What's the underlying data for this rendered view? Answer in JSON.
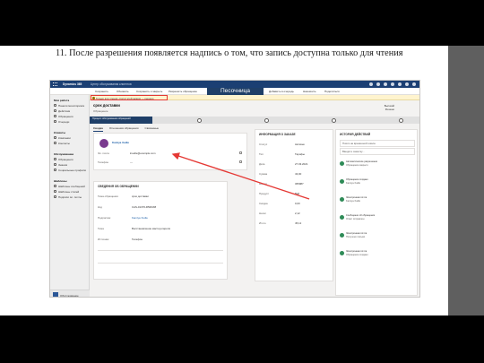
{
  "slide": {
    "caption": "11. После разрешения появляется надпись о том, что запись доступна только для чтения",
    "colors": {
      "background": "#000000",
      "slide": "#ffffff",
      "right_band": "#5f5f5f",
      "arrow": "#e53935"
    }
  },
  "app": {
    "brand": "Dynamics 365",
    "env": "Центр обслуживания клиентов",
    "sandbox_label": "Песочница",
    "commands": [
      "Сохранить",
      "Обновить",
      "Сохранить и закрыть",
      "Разрешить обращение",
      "Отменить обращение",
      "Добавить в очередь",
      "Назначить",
      "Поделиться"
    ],
    "banner_text": "Только для чтения: статус этой записи — решено",
    "sidebar": {
      "groups": [
        {
          "title": "Моя работа",
          "items": [
            "Панели мониторинга",
            "Действия",
            "Обращения",
            "Очереди"
          ]
        },
        {
          "title": "Клиенты",
          "items": [
            "Компании",
            "Контакты"
          ]
        },
        {
          "title": "Обслуживание",
          "items": [
            "Обращения",
            "Знания",
            "Социальные профили"
          ]
        },
        {
          "title": "Шаблоны",
          "items": [
            "Шаблоны сообщений",
            "Шаблоны статей",
            "Подписи эл. почты"
          ]
        }
      ],
      "area_label": "Обслуживание"
    },
    "record": {
      "title": "срок доставки",
      "subtitle": "Обращение",
      "owner": "Kamiya Xudle",
      "priority": "Высокий",
      "status": "Решено"
    },
    "bpf_stages": [
      "Определение",
      "Исследование",
      "Решение"
    ],
    "bpf_active_label": "Процесс обслуживания обращений",
    "tabs": [
      "Сводка",
      "Отношения обращения",
      "Связанные"
    ],
    "contact": {
      "name": "Kamiya Xudle",
      "email_label": "Эл. почта",
      "email": "kxudle@example.com",
      "phone_label": "Телефон",
      "phone": "---"
    },
    "case_details": {
      "title": "СВЕДЕНИЯ ОБ ОБРАЩЕНИИ",
      "fields": [
        {
          "label": "Тема обращения",
          "value": "срок доставки"
        },
        {
          "label": "Код",
          "value": "CAS-01376-R5M4X8"
        },
        {
          "label": "Подписчик",
          "value": "Kamiya Xudle"
        },
        {
          "label": "Тема",
          "value": "Восстановление мастер-пароля"
        },
        {
          "label": "Источник",
          "value": "Телефон"
        }
      ]
    },
    "info": {
      "title": "ИНФОРМАЦИЯ О ЗАКАЗЕ",
      "fields": [
        {
          "label": "Статус",
          "value": "Активно"
        },
        {
          "label": "Тип",
          "value": "Тарифы"
        },
        {
          "label": "Дата",
          "value": "27.03.2021"
        },
        {
          "label": "Сумма",
          "value": "43,00"
        },
        {
          "label": "Номер",
          "value": "365987"
        },
        {
          "label": "Продукт",
          "value": "Вай"
        },
        {
          "label": "Скидка",
          "value": "0,00"
        },
        {
          "label": "Налог",
          "value": "2,12"
        },
        {
          "label": "Итого",
          "value": "45,12"
        }
      ]
    },
    "timeline": {
      "title": "ИСТОРИЯ ДЕЙСТВИЙ",
      "search_placeholder": "Поиск на временной шкале",
      "note_placeholder": "Введите заметку...",
      "items": [
        {
          "line1": "Автоматическое разрешение",
          "line2": "Обращение закрыто"
        },
        {
          "line1": "Обращение создано",
          "line2": "Kamiya Xudle"
        },
        {
          "line1": "Электронная почта",
          "line2": "Kamiya Xudle"
        },
        {
          "line1": "Сообщение об обращении",
          "line2": "Ответ отправлен"
        },
        {
          "line1": "Электронная почта",
          "line2": "Получено письмо"
        },
        {
          "line1": "Электронная почта",
          "line2": "Обращение создано"
        }
      ]
    }
  }
}
